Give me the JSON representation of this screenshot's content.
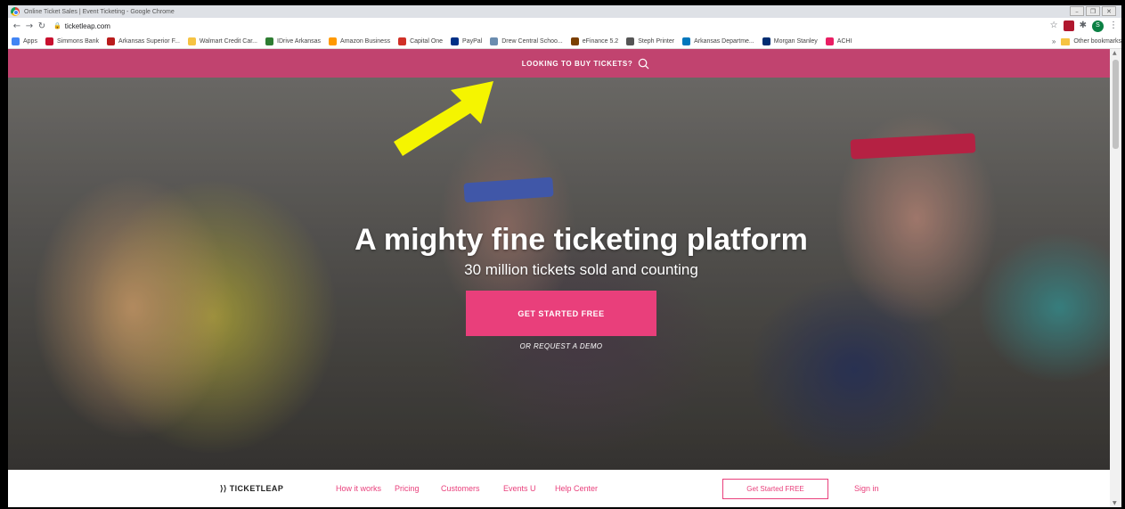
{
  "browser": {
    "window_title": "Online Ticket Sales | Event Ticketing - Google Chrome",
    "url": "ticketleap.com",
    "bookmarks": [
      {
        "label": "Apps",
        "color": "#4285f4"
      },
      {
        "label": "Simmons Bank",
        "color": "#c8102e"
      },
      {
        "label": "Arkansas Superior F...",
        "color": "#b91c1c"
      },
      {
        "label": "Walmart Credit Car...",
        "color": "#f6c343"
      },
      {
        "label": "IDrive Arkansas",
        "color": "#2e7d32"
      },
      {
        "label": "Amazon Business",
        "color": "#ff9900"
      },
      {
        "label": "Capital One",
        "color": "#d03027"
      },
      {
        "label": "PayPal",
        "color": "#003087"
      },
      {
        "label": "Drew Central Schoo...",
        "color": "#6a8caf"
      },
      {
        "label": "eFinance 5.2",
        "color": "#7b3f00"
      },
      {
        "label": "Steph Printer",
        "color": "#555555"
      },
      {
        "label": "Arkansas Departme...",
        "color": "#0277bd"
      },
      {
        "label": "Morgan Stanley",
        "color": "#002d72"
      },
      {
        "label": "ACHI",
        "color": "#e91e63"
      }
    ],
    "other_bookmarks": "Other bookmarks",
    "avatar_letter": "S"
  },
  "site": {
    "top_banner": "LOOKING TO BUY TICKETS?",
    "headline": "A mighty fine ticketing platform",
    "subheadline": "30 million tickets sold and counting",
    "cta_label": "GET STARTED FREE",
    "demo_label": "OR REQUEST A DEMO",
    "nav": {
      "logo": "TICKETLEAP",
      "links": [
        "How it works",
        "Pricing",
        "Customers",
        "Events U",
        "Help Center"
      ],
      "start_button": "Get Started FREE",
      "sign_in": "Sign in"
    },
    "colors": {
      "brand_pink": "#e93f7b",
      "banner_pink": "#c94070",
      "annotation_arrow": "#f5f500"
    }
  }
}
